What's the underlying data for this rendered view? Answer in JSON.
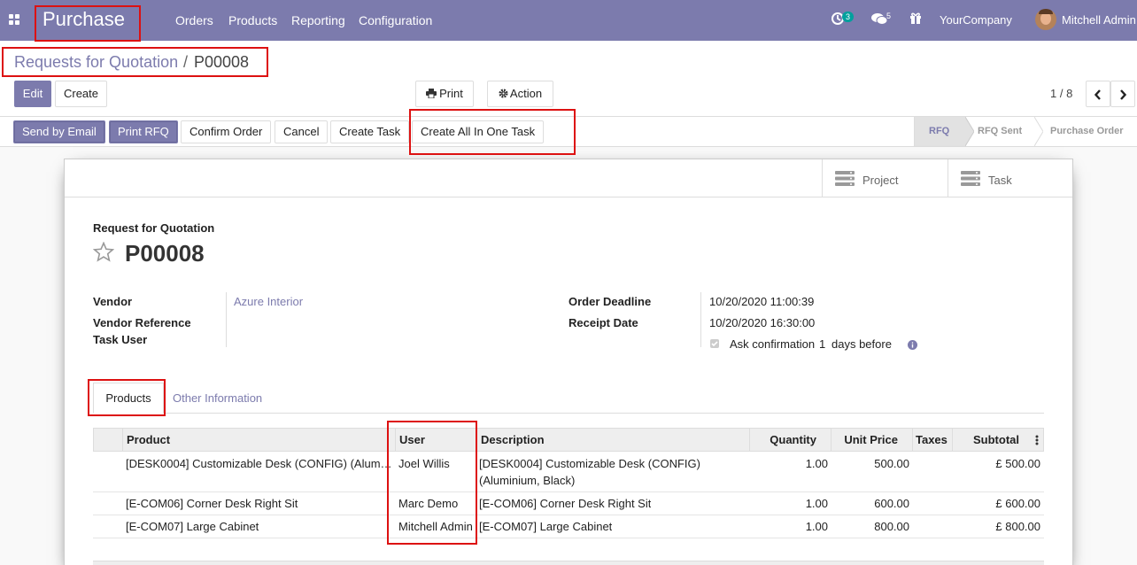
{
  "navbar": {
    "app_name": "Purchase",
    "menus": [
      "Orders",
      "Products",
      "Reporting",
      "Configuration"
    ],
    "activity_count": "3",
    "message_count": "5",
    "company": "YourCompany",
    "user": "Mitchell Admin"
  },
  "breadcrumb": {
    "parent": "Requests for Quotation",
    "separator": "/",
    "current": "P00008"
  },
  "toolbar": {
    "edit": "Edit",
    "create": "Create",
    "print": "Print",
    "action": "Action",
    "pager": "1 / 8"
  },
  "statusbar": {
    "buttons": [
      "Send by Email",
      "Print RFQ",
      "Confirm Order",
      "Cancel",
      "Create Task",
      "Create All In One Task"
    ],
    "stages": [
      "RFQ",
      "RFQ Sent",
      "Purchase Order"
    ],
    "active_stage": "RFQ"
  },
  "smart_buttons": {
    "project": "Project",
    "task": "Task"
  },
  "form": {
    "doc_type": "Request for Quotation",
    "name": "P00008",
    "vendor_label": "Vendor",
    "vendor": "Azure Interior",
    "vendor_ref_label": "Vendor Reference",
    "task_user_label": "Task User",
    "deadline_label": "Order Deadline",
    "deadline": "10/20/2020 11:00:39",
    "receipt_label": "Receipt Date",
    "receipt": "10/20/2020 16:30:00",
    "ask_confirm_pre": "Ask confirmation",
    "ask_confirm_days": "1",
    "ask_confirm_post": "days before"
  },
  "tabs": [
    "Products",
    "Other Information"
  ],
  "lines": {
    "headers": {
      "product": "Product",
      "user": "User",
      "description": "Description",
      "quantity": "Quantity",
      "unit_price": "Unit Price",
      "taxes": "Taxes",
      "subtotal": "Subtotal"
    },
    "rows": [
      {
        "product": "[DESK0004] Customizable Desk (CONFIG) (Alum…",
        "user": "Joel Willis",
        "description": "[DESK0004] Customizable Desk (CONFIG)",
        "description2": "(Aluminium, Black)",
        "quantity": "1.00",
        "unit_price": "500.00",
        "subtotal": "£ 500.00"
      },
      {
        "product": "[E-COM06] Corner Desk Right Sit",
        "user": "Marc Demo",
        "description": "[E-COM06] Corner Desk Right Sit",
        "description2": "",
        "quantity": "1.00",
        "unit_price": "600.00",
        "subtotal": "£ 600.00"
      },
      {
        "product": "[E-COM07] Large Cabinet",
        "user": "Mitchell Admin",
        "description": "[E-COM07] Large Cabinet",
        "description2": "",
        "quantity": "1.00",
        "unit_price": "800.00",
        "subtotal": "£ 800.00"
      }
    ]
  },
  "colors": {
    "brand": "#7c7bad",
    "highlight": "#dd1111",
    "link": "#7c7bad"
  }
}
